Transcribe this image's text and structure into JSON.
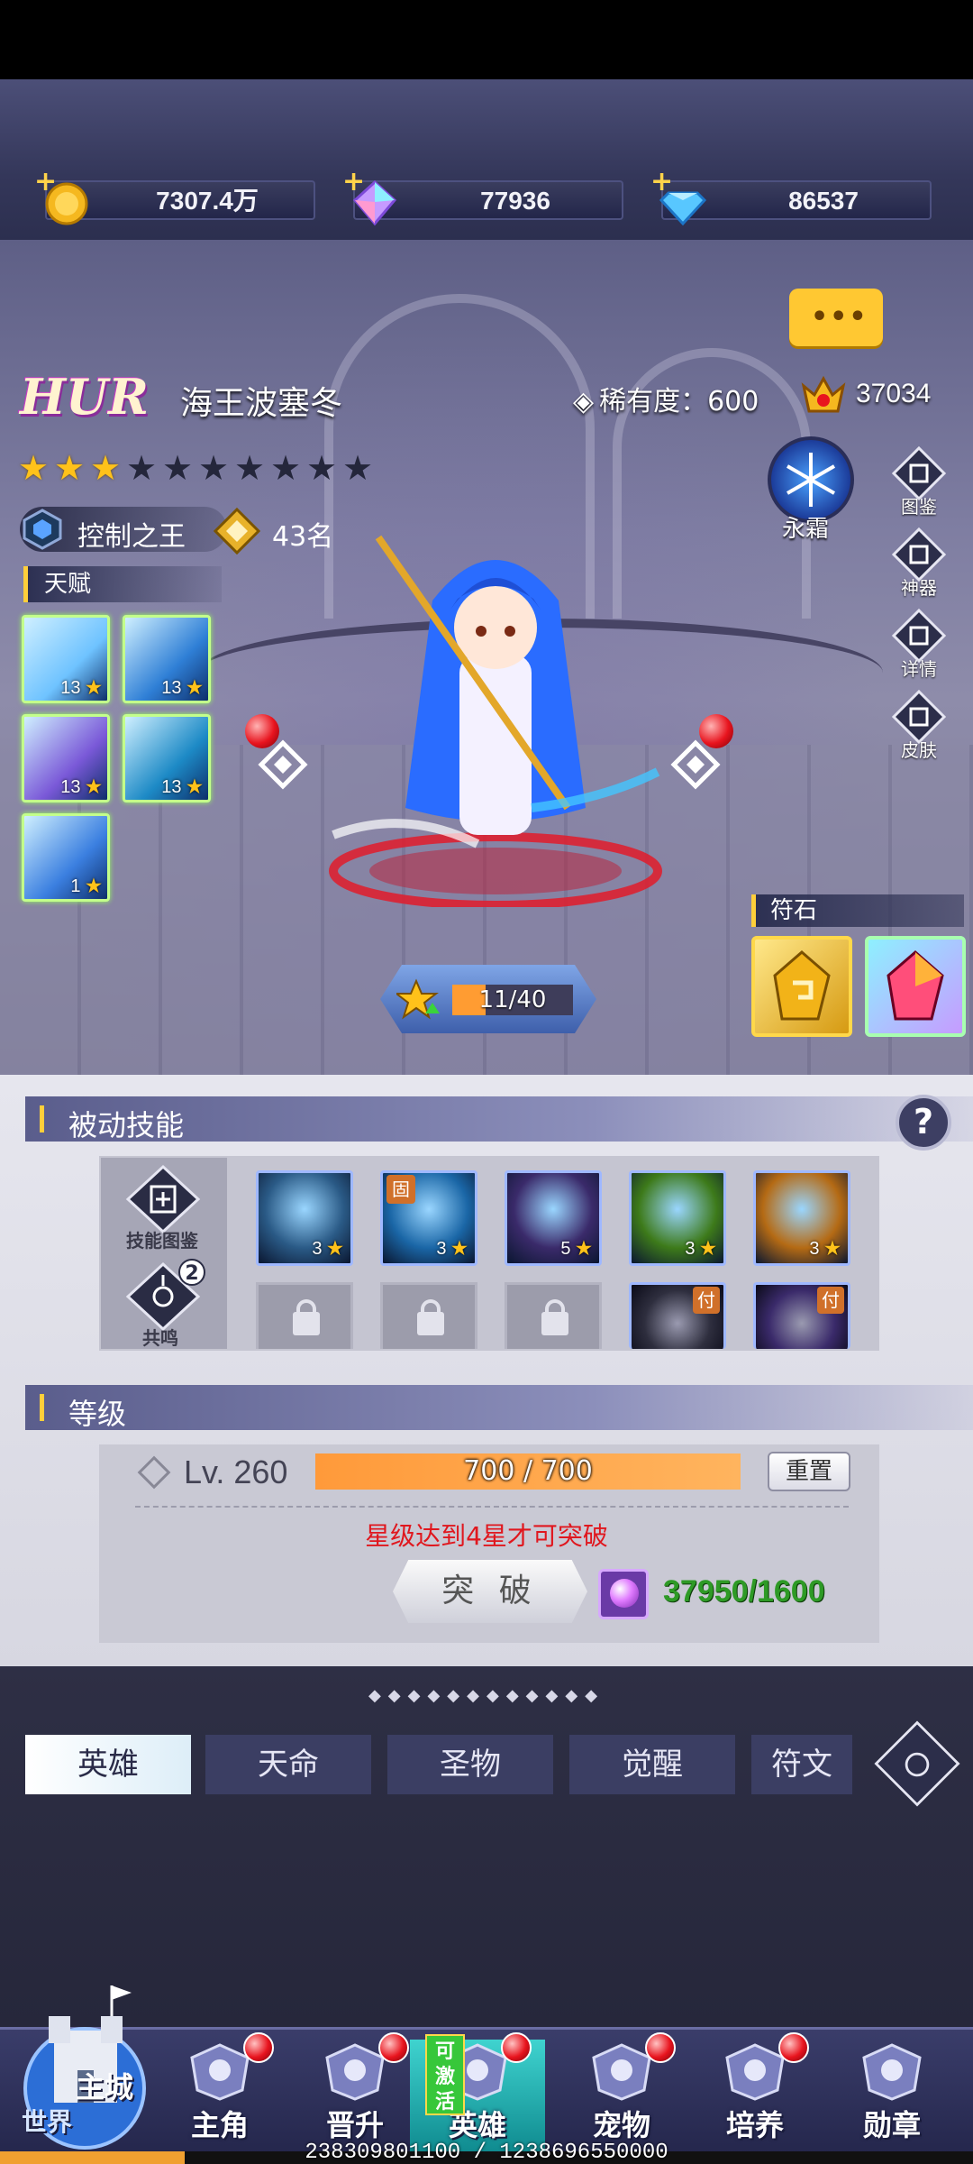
{
  "resources": [
    {
      "icon": "gold-coin-icon",
      "value": "7307.4万"
    },
    {
      "icon": "rainbow-crystal-icon",
      "value": "77936"
    },
    {
      "icon": "diamond-icon",
      "value": "86537"
    }
  ],
  "hero": {
    "grade": "HUR",
    "name": "海王波塞冬",
    "rarity_label": "稀有度：",
    "rarity_value": "600",
    "power": "37034",
    "stars_total": 10,
    "stars_filled": 3,
    "role": "控制之王",
    "rank": "43名",
    "element": "永霜"
  },
  "talent": {
    "title": "天赋",
    "items": [
      {
        "level": "13",
        "color": "#6fc3ff"
      },
      {
        "level": "13",
        "color": "#2f7fd6"
      },
      {
        "level": "13",
        "color": "#7a59d8"
      },
      {
        "level": "13",
        "color": "#1d8ac6"
      },
      {
        "level": "1",
        "color": "#3b7fe0"
      }
    ]
  },
  "side_buttons": [
    {
      "icon": "codex-icon",
      "label": "图鉴"
    },
    {
      "icon": "artifact-icon",
      "label": "神器"
    },
    {
      "icon": "details-icon",
      "label": "详情"
    },
    {
      "icon": "skin-icon",
      "label": "皮肤"
    }
  ],
  "rune": {
    "title": "符石",
    "items": [
      {
        "icon": "gold-rune-icon",
        "color": "#ffce2a"
      },
      {
        "icon": "rainbow-rune-icon",
        "color": "#ff5a8a"
      }
    ]
  },
  "exp": {
    "text": "11/40",
    "fraction": 0.275
  },
  "passive": {
    "title": "被动技能",
    "codex_label": "技能图鉴",
    "resonance_label": "共鸣",
    "resonance_count": "2",
    "skills": [
      {
        "level": "3",
        "color": "#2a5a86"
      },
      {
        "level": "3",
        "color": "#1a66a6",
        "tag": "固"
      },
      {
        "level": "5",
        "color": "#3a2a6a"
      },
      {
        "level": "3",
        "color": "#3d7a1a"
      },
      {
        "level": "3",
        "color": "#b46a14"
      }
    ],
    "second_row": [
      {
        "type": "locked"
      },
      {
        "type": "locked"
      },
      {
        "type": "locked"
      },
      {
        "type": "skill",
        "color": "#2e2e3e",
        "tag": "付"
      },
      {
        "type": "skill",
        "color": "#3a2a6a",
        "tag": "付"
      }
    ]
  },
  "level": {
    "title": "等级",
    "label": "Lv. 260",
    "bar_text": "700 / 700",
    "reset": "重置",
    "warning": "星级达到4星才可突破",
    "break_button": "突 破",
    "cost": "37950/1600"
  },
  "tabs": [
    "英雄",
    "天命",
    "圣物",
    "觉醒",
    "符文"
  ],
  "nav": {
    "main_city": "主城",
    "world": "世界",
    "items": [
      "主角",
      "晋升",
      "英雄",
      "宠物",
      "培养",
      "勋章"
    ],
    "activate_badge": "可激活"
  },
  "footer": {
    "text": "238309801100 / 1238696550000",
    "fraction": 0.19
  }
}
